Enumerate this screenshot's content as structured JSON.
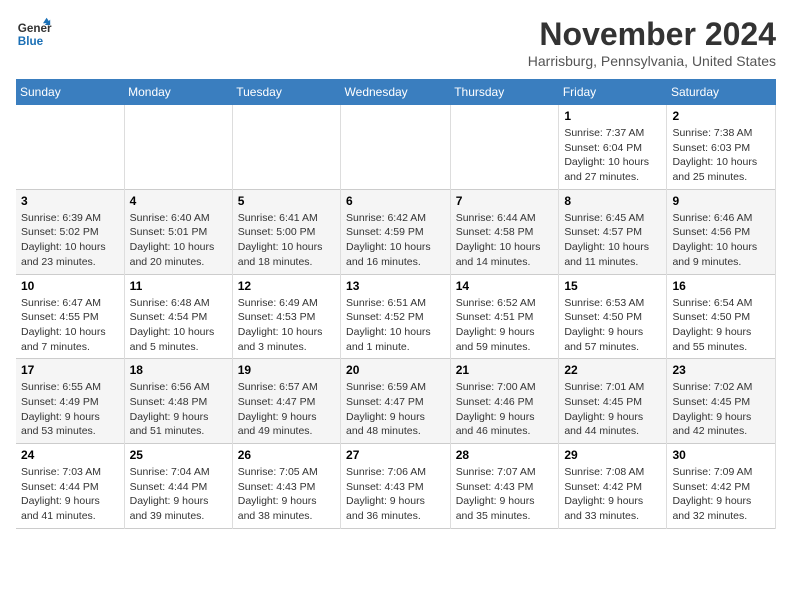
{
  "logo": {
    "line1": "General",
    "line2": "Blue"
  },
  "title": "November 2024",
  "location": "Harrisburg, Pennsylvania, United States",
  "days_of_week": [
    "Sunday",
    "Monday",
    "Tuesday",
    "Wednesday",
    "Thursday",
    "Friday",
    "Saturday"
  ],
  "weeks": [
    [
      {
        "day": "",
        "info": ""
      },
      {
        "day": "",
        "info": ""
      },
      {
        "day": "",
        "info": ""
      },
      {
        "day": "",
        "info": ""
      },
      {
        "day": "",
        "info": ""
      },
      {
        "day": "1",
        "info": "Sunrise: 7:37 AM\nSunset: 6:04 PM\nDaylight: 10 hours and 27 minutes."
      },
      {
        "day": "2",
        "info": "Sunrise: 7:38 AM\nSunset: 6:03 PM\nDaylight: 10 hours and 25 minutes."
      }
    ],
    [
      {
        "day": "3",
        "info": "Sunrise: 6:39 AM\nSunset: 5:02 PM\nDaylight: 10 hours and 23 minutes."
      },
      {
        "day": "4",
        "info": "Sunrise: 6:40 AM\nSunset: 5:01 PM\nDaylight: 10 hours and 20 minutes."
      },
      {
        "day": "5",
        "info": "Sunrise: 6:41 AM\nSunset: 5:00 PM\nDaylight: 10 hours and 18 minutes."
      },
      {
        "day": "6",
        "info": "Sunrise: 6:42 AM\nSunset: 4:59 PM\nDaylight: 10 hours and 16 minutes."
      },
      {
        "day": "7",
        "info": "Sunrise: 6:44 AM\nSunset: 4:58 PM\nDaylight: 10 hours and 14 minutes."
      },
      {
        "day": "8",
        "info": "Sunrise: 6:45 AM\nSunset: 4:57 PM\nDaylight: 10 hours and 11 minutes."
      },
      {
        "day": "9",
        "info": "Sunrise: 6:46 AM\nSunset: 4:56 PM\nDaylight: 10 hours and 9 minutes."
      }
    ],
    [
      {
        "day": "10",
        "info": "Sunrise: 6:47 AM\nSunset: 4:55 PM\nDaylight: 10 hours and 7 minutes."
      },
      {
        "day": "11",
        "info": "Sunrise: 6:48 AM\nSunset: 4:54 PM\nDaylight: 10 hours and 5 minutes."
      },
      {
        "day": "12",
        "info": "Sunrise: 6:49 AM\nSunset: 4:53 PM\nDaylight: 10 hours and 3 minutes."
      },
      {
        "day": "13",
        "info": "Sunrise: 6:51 AM\nSunset: 4:52 PM\nDaylight: 10 hours and 1 minute."
      },
      {
        "day": "14",
        "info": "Sunrise: 6:52 AM\nSunset: 4:51 PM\nDaylight: 9 hours and 59 minutes."
      },
      {
        "day": "15",
        "info": "Sunrise: 6:53 AM\nSunset: 4:50 PM\nDaylight: 9 hours and 57 minutes."
      },
      {
        "day": "16",
        "info": "Sunrise: 6:54 AM\nSunset: 4:50 PM\nDaylight: 9 hours and 55 minutes."
      }
    ],
    [
      {
        "day": "17",
        "info": "Sunrise: 6:55 AM\nSunset: 4:49 PM\nDaylight: 9 hours and 53 minutes."
      },
      {
        "day": "18",
        "info": "Sunrise: 6:56 AM\nSunset: 4:48 PM\nDaylight: 9 hours and 51 minutes."
      },
      {
        "day": "19",
        "info": "Sunrise: 6:57 AM\nSunset: 4:47 PM\nDaylight: 9 hours and 49 minutes."
      },
      {
        "day": "20",
        "info": "Sunrise: 6:59 AM\nSunset: 4:47 PM\nDaylight: 9 hours and 48 minutes."
      },
      {
        "day": "21",
        "info": "Sunrise: 7:00 AM\nSunset: 4:46 PM\nDaylight: 9 hours and 46 minutes."
      },
      {
        "day": "22",
        "info": "Sunrise: 7:01 AM\nSunset: 4:45 PM\nDaylight: 9 hours and 44 minutes."
      },
      {
        "day": "23",
        "info": "Sunrise: 7:02 AM\nSunset: 4:45 PM\nDaylight: 9 hours and 42 minutes."
      }
    ],
    [
      {
        "day": "24",
        "info": "Sunrise: 7:03 AM\nSunset: 4:44 PM\nDaylight: 9 hours and 41 minutes."
      },
      {
        "day": "25",
        "info": "Sunrise: 7:04 AM\nSunset: 4:44 PM\nDaylight: 9 hours and 39 minutes."
      },
      {
        "day": "26",
        "info": "Sunrise: 7:05 AM\nSunset: 4:43 PM\nDaylight: 9 hours and 38 minutes."
      },
      {
        "day": "27",
        "info": "Sunrise: 7:06 AM\nSunset: 4:43 PM\nDaylight: 9 hours and 36 minutes."
      },
      {
        "day": "28",
        "info": "Sunrise: 7:07 AM\nSunset: 4:43 PM\nDaylight: 9 hours and 35 minutes."
      },
      {
        "day": "29",
        "info": "Sunrise: 7:08 AM\nSunset: 4:42 PM\nDaylight: 9 hours and 33 minutes."
      },
      {
        "day": "30",
        "info": "Sunrise: 7:09 AM\nSunset: 4:42 PM\nDaylight: 9 hours and 32 minutes."
      }
    ]
  ]
}
